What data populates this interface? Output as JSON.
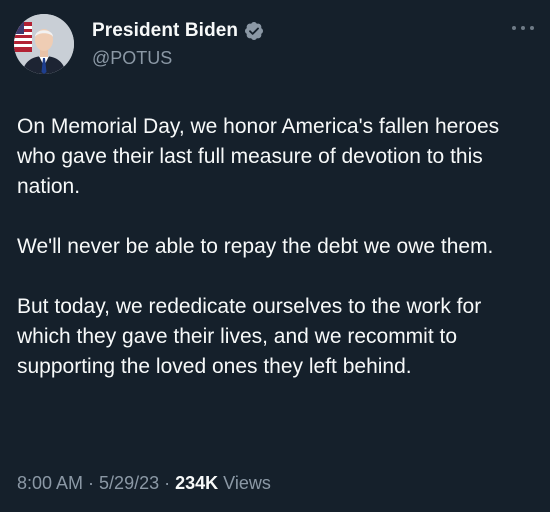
{
  "tweet": {
    "author": {
      "display_name": "President Biden",
      "handle": "@POTUS",
      "verified": true,
      "avatar_icon": "avatar-photo",
      "verified_color": "#8b98a5"
    },
    "more_icon": "more-horizontal-icon",
    "paragraphs": [
      "On Memorial Day, we honor America's fallen heroes who gave their last full measure of devotion to this nation.",
      "We'll never be able to repay the debt we owe them.",
      "But today, we rededicate ourselves to the work for which they gave their lives, and we recommit to supporting the loved ones they left behind."
    ],
    "time": "8:00 AM",
    "separator": "·",
    "date": "5/29/23",
    "views_count": "234K",
    "views_label": "Views"
  },
  "theme": {
    "background": "#15202b",
    "text_primary": "#f7f9f9",
    "text_secondary": "#8b98a5"
  }
}
